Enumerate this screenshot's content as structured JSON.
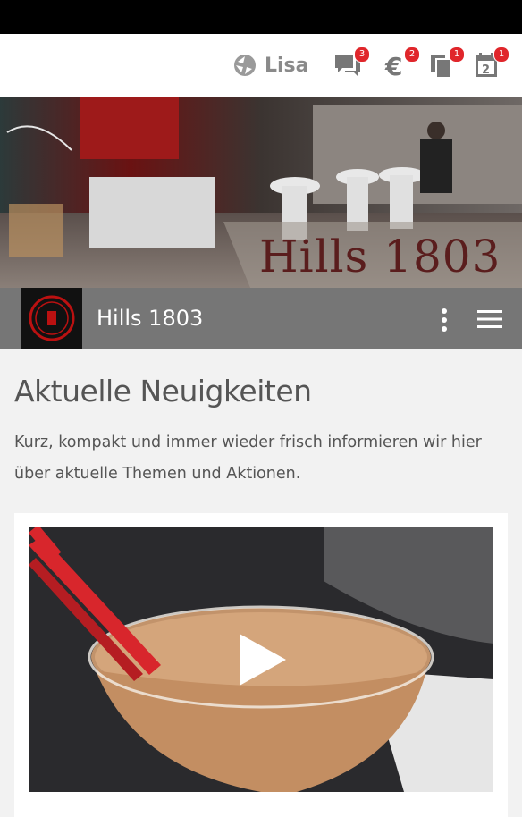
{
  "header": {
    "user_name": "Lisa",
    "icons": [
      {
        "name": "chat-icon",
        "badge": "3"
      },
      {
        "name": "euro-icon",
        "badge": "2"
      },
      {
        "name": "copy-icon",
        "badge": "1"
      },
      {
        "name": "calendar-icon",
        "badge": "1",
        "day": "2"
      }
    ]
  },
  "banner": {
    "image_text": "Hills 1803"
  },
  "titlebar": {
    "title": "Hills 1803"
  },
  "main": {
    "heading": "Aktuelle Neuigkeiten",
    "lead": "Kurz, kompakt und immer wieder frisch informieren wir hier über aktuelle Themen und Aktionen."
  },
  "colors": {
    "accent": "#e0262b",
    "titlebar": "#767676"
  }
}
